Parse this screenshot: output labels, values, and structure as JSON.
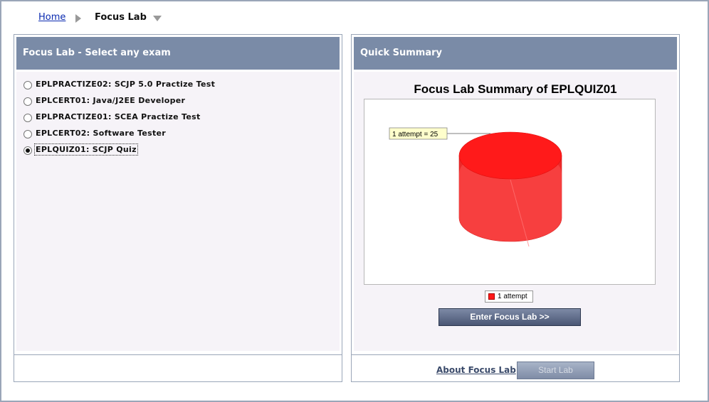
{
  "breadcrumb": {
    "home": "Home",
    "current": "Focus Lab"
  },
  "left_panel": {
    "title": "Focus Lab - Select any exam",
    "exams": [
      {
        "label": "EPLPRACTIZE02: SCJP 5.0 Practize Test",
        "selected": false
      },
      {
        "label": "EPLCERT01: Java/J2EE Developer",
        "selected": false
      },
      {
        "label": "EPLPRACTIZE01: SCEA Practize Test",
        "selected": false
      },
      {
        "label": "EPLCERT02: Software Tester",
        "selected": false
      },
      {
        "label": "EPLQUIZ01: SCJP Quiz",
        "selected": true
      }
    ]
  },
  "right_panel": {
    "title": "Quick Summary",
    "enter_button": "Enter Focus Lab >>",
    "about_link": "About Focus Lab",
    "start_button": "Start Lab"
  },
  "chart_data": {
    "type": "pie",
    "title": "Focus Lab Summary of EPLQUIZ01",
    "slices": [
      {
        "label": "1 attempt",
        "value": 25,
        "callout": "1 attempt  = 25",
        "color": "#ff1a1a"
      }
    ],
    "legend": [
      "1 attempt"
    ],
    "legend_placement": "bottom"
  },
  "colors": {
    "header_bg": "#7a8ba7",
    "panel_body": "#f6f3f8",
    "pie_red": "#ff1a1a",
    "link_blue": "#0a2ab0"
  }
}
